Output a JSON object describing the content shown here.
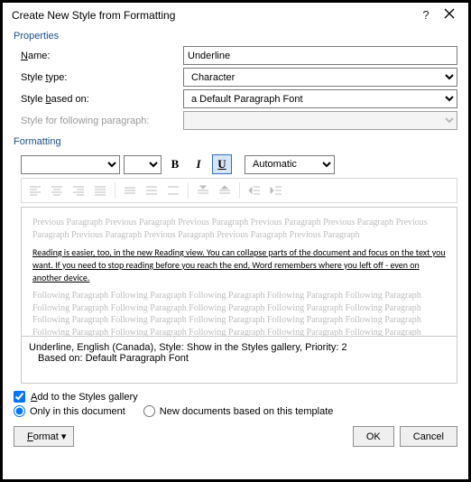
{
  "title": "Create New Style from Formatting",
  "sections": {
    "properties": "Properties",
    "formatting": "Formatting"
  },
  "labels": {
    "name": "Name:",
    "styleType": "Style type:",
    "basedOn": "Style based on:",
    "following": "Style for following paragraph:"
  },
  "fields": {
    "name": "Underline",
    "styleType": "Character",
    "basedOn": "a Default Paragraph Font",
    "following": ""
  },
  "fmt": {
    "bold": "B",
    "italic": "I",
    "underline": "U",
    "color": "Automatic"
  },
  "preview": {
    "before": "Previous Paragraph Previous Paragraph Previous Paragraph Previous Paragraph Previous Paragraph Previous Paragraph Previous Paragraph Previous Paragraph Previous Paragraph Previous Paragraph",
    "sample": "Reading is easier, too, in the new Reading view. You can collapse parts of the document and focus on the text you want. If you need to stop reading before you reach the end, Word remembers where you left off - even on another device.",
    "after": "Following Paragraph Following Paragraph Following Paragraph Following Paragraph Following Paragraph Following Paragraph Following Paragraph Following Paragraph Following Paragraph Following Paragraph Following Paragraph Following Paragraph Following Paragraph Following Paragraph Following Paragraph Following Paragraph Following Paragraph Following Paragraph Following Paragraph Following Paragraph"
  },
  "desc": {
    "line1": "Underline, English (Canada), Style: Show in the Styles gallery, Priority: 2",
    "line2": "Based on: Default Paragraph Font"
  },
  "options": {
    "addGallery": "Add to the Styles gallery",
    "onlyDoc": "Only in this document",
    "newDocs": "New documents based on this template"
  },
  "buttons": {
    "format": "Format ▾",
    "ok": "OK",
    "cancel": "Cancel"
  },
  "titlebar_help": "?"
}
